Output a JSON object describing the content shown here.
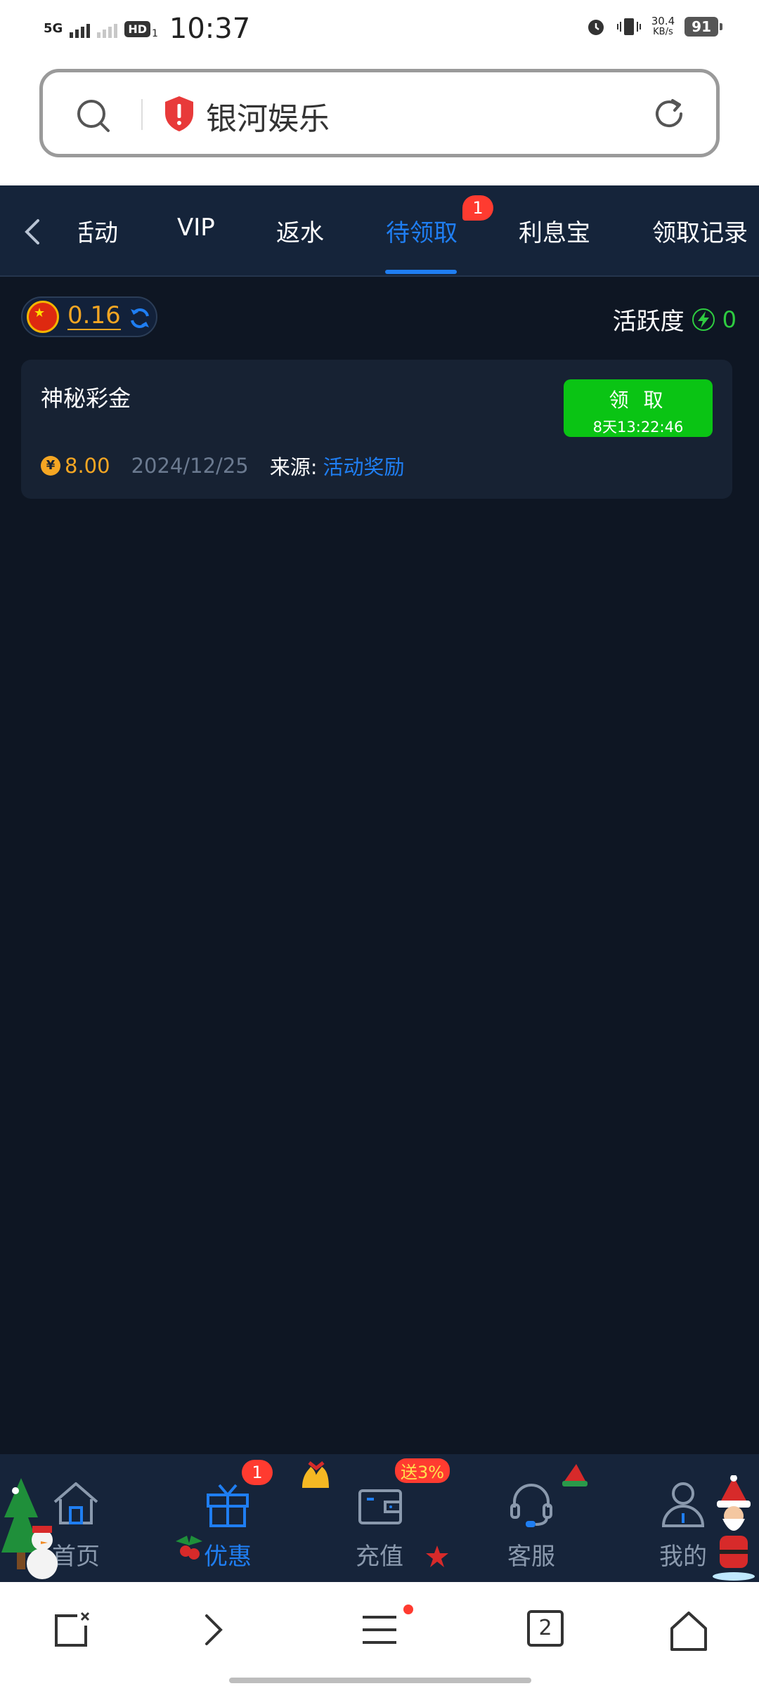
{
  "status_bar": {
    "network": "5G",
    "hd": "HD",
    "sim": "1",
    "time": "10:37",
    "speed_value": "30.4",
    "speed_unit": "KB/s",
    "battery": "91"
  },
  "address_bar": {
    "site_name": "银河娱乐",
    "icons": [
      "search-icon",
      "security-warning-icon",
      "reload-icon"
    ]
  },
  "tabs": {
    "items": [
      {
        "label": "活动"
      },
      {
        "label": "VIP"
      },
      {
        "label": "返水"
      },
      {
        "label": "待领取",
        "active": true,
        "badge": "1"
      },
      {
        "label": "利息宝"
      },
      {
        "label": "领取记录"
      }
    ],
    "partial_first_label": "活动"
  },
  "balance": {
    "value": "0.16",
    "currency_flag": "china-flag-icon"
  },
  "activity": {
    "label": "活跃度",
    "value": "0"
  },
  "rewards": [
    {
      "title": "神秘彩金",
      "amount": "8.00",
      "coin_symbol": "¥",
      "date": "2024/12/25",
      "source_label": "来源:",
      "source_value": "活动奖励",
      "claim_label": "领 取",
      "countdown": "8天13:22:46"
    }
  ],
  "site_nav": {
    "items": [
      {
        "label": "首页",
        "icon": "home-icon"
      },
      {
        "label": "优惠",
        "icon": "gift-icon",
        "active": true,
        "badge": "1"
      },
      {
        "label": "充值",
        "icon": "wallet-icon",
        "badge": "送3%"
      },
      {
        "label": "客服",
        "icon": "headset-icon"
      },
      {
        "label": "我的",
        "icon": "user-icon"
      }
    ]
  },
  "browser_toolbar": {
    "tabs_count": "2",
    "icons": [
      "new-window-icon",
      "forward-icon",
      "menu-icon",
      "tabs-icon",
      "home-icon"
    ]
  },
  "colors": {
    "accent": "#1f7ef2",
    "claim_green": "#0ac414",
    "amount_orange": "#f5a623",
    "background": "#0e1623",
    "badge_red": "#ff3b30"
  }
}
